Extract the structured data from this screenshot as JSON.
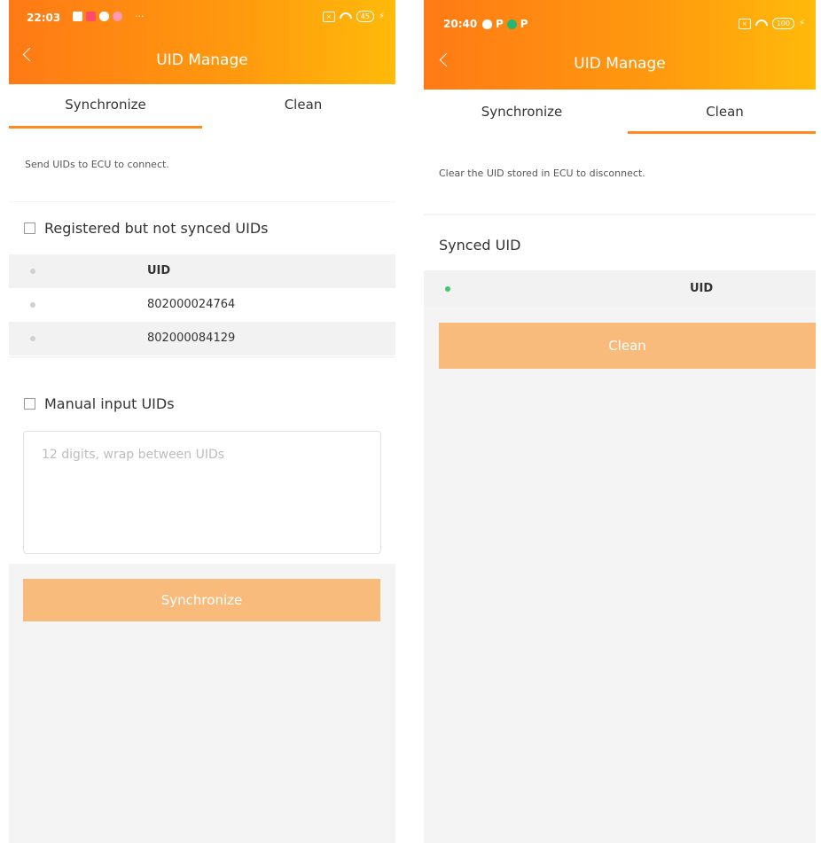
{
  "left": {
    "status": {
      "time": "22:03",
      "battery": "45",
      "more": "···"
    },
    "nav": {
      "title": "UID Manage"
    },
    "tabs": [
      {
        "label": "Synchronize"
      },
      {
        "label": "Clean"
      }
    ],
    "description": "Send UIDs to ECU to connect.",
    "registered": {
      "checkbox_label": "Registered but not synced UIDs",
      "header": "UID",
      "rows": [
        "802000024764",
        "802000084129"
      ]
    },
    "manual": {
      "checkbox_label": "Manual input UIDs",
      "placeholder": "12 digits, wrap between UIDs"
    },
    "button": {
      "label": "Synchronize"
    }
  },
  "right": {
    "status": {
      "time": "20:40",
      "battery": "100"
    },
    "nav": {
      "title": "UID Manage"
    },
    "tabs": [
      {
        "label": "Synchronize"
      },
      {
        "label": "Clean"
      }
    ],
    "description": "Clear the UID stored in ECU to disconnect.",
    "synced": {
      "title": "Synced UID",
      "header": "UID"
    },
    "button": {
      "label": "Clean"
    }
  },
  "colors": {
    "accent": "#ff8a1e",
    "button": "#f8bb7b",
    "synced_dot": "#3cc86b"
  }
}
